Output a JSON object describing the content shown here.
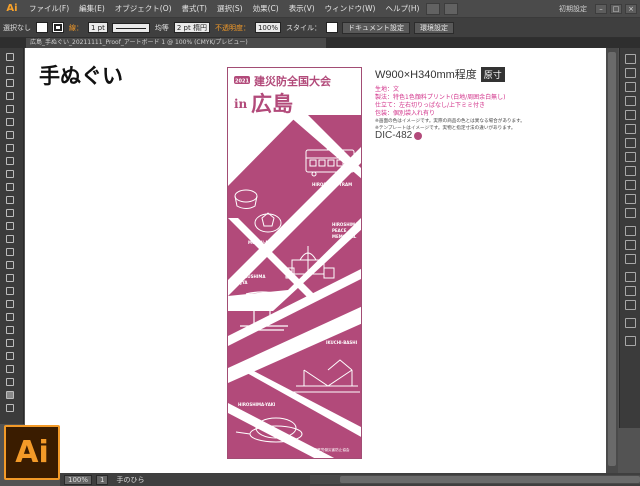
{
  "menubar": {
    "logo": "Ai",
    "items": [
      "ファイル(F)",
      "編集(E)",
      "オブジェクト(O)",
      "書式(T)",
      "選択(S)",
      "効果(C)",
      "表示(V)",
      "ウィンドウ(W)",
      "ヘルプ(H)"
    ],
    "workspace": "初期設定"
  },
  "controlbar": {
    "selection": "選択なし",
    "stroke_label": "線：",
    "stroke_width": "1 pt",
    "profile": "均等",
    "brush": "2 pt 楕円",
    "opacity_label": "不透明度：",
    "opacity_value": "100%",
    "style_label": "スタイル：",
    "doc_settings": "ドキュメント設定",
    "env_settings": "環境設定"
  },
  "document": {
    "tab_title": "広島_手ぬぐい_20211111_Proof_アートボード 1 @ 100% (CMYK/プレビュー)"
  },
  "product": {
    "title": "手ぬぐい",
    "size": "W900×H340mm程度",
    "size_badge": "原寸",
    "specs": [
      "生地：文",
      "製法：特色1色顔料プリント(白地/周囲余白無し)",
      "仕立て：左右切りっぱなし/上下ミミ付き",
      "包装：個別袋入れ有り"
    ],
    "notes": [
      "※画面の色はイメージです。実際の商品の色とは異なる場合があります。",
      "※テンプレートはイメージです。実物と指定寸法の違いがあります。"
    ],
    "dic_code": "DIC-482",
    "dic_color": "#b24a7a"
  },
  "towel": {
    "badge": "2021",
    "header_line1": "建災防全国大会",
    "header_in": "in",
    "header_line2": "広島",
    "labels": {
      "tram": "HIROSHIMA-TRAM",
      "manju": "MOMIJI-MANJU",
      "memorial1": "HIROSHIMA",
      "memorial2": "PEACE",
      "memorial3": "MEMORIAL",
      "jinja1": "ITSUKUSHIMA",
      "jinja2": "JINJYA",
      "bashi": "IKUCHI-BASHI",
      "yaki": "HIROSHIMA-YAKI"
    },
    "footer": "建設業労働災害防止協会",
    "accent": "#b24a7a"
  },
  "statusbar": {
    "zoom": "100%",
    "page": "1",
    "tool": "手のひら"
  }
}
